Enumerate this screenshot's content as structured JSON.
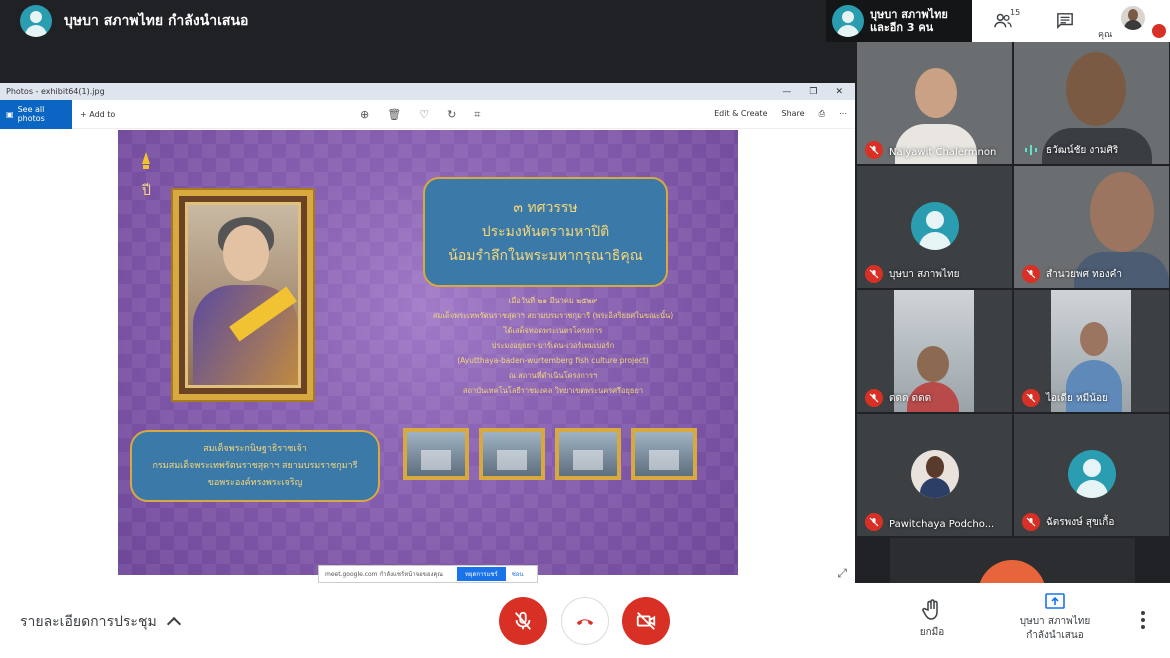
{
  "presenter": {
    "name": "บุษบา สภาพไทย กำลังนำเสนอ"
  },
  "others": {
    "line1": "บุษบา สภาพไทย",
    "line2": "และอีก 3 คน"
  },
  "header": {
    "participant_count": "15",
    "self_label": "คุณ"
  },
  "photos_app": {
    "window_title": "Photos - exhibit64(1).jpg",
    "see_all": "See all photos",
    "add_to": "+ Add to",
    "edit_create": "Edit & Create",
    "share": "Share"
  },
  "poster": {
    "corner_glyph": "ปี",
    "title_lines": [
      "๓ ทศวรรษ",
      "ประมงหันตรามหาปิติ",
      "น้อมรำลึกในพระมหากรุณาธิคุณ"
    ],
    "details": [
      "เมื่อวันที่ ๒๑ มีนาคม ๒๕๒๙",
      "สมเด็จพระเทพรัตนราชสุดาฯ สยามบรมราชกุมารี (พระอิสริยยศในขณะนั้น)",
      "ได้เสด็จทอดพระเนตรโครงการ",
      "ประมงอยุธยา-บาร์เดน-เวอร์เทมเบอร์ก",
      "(Ayutthaya-baden-wurtemberg fish culture project)",
      "ณ สถานที่ดำเนินโครงการฯ",
      "สถาบันเทคโนโลยีราชมงคล วิทยาเขตพระนครศรีอยุธยา"
    ],
    "caption_lines": [
      "สมเด็จพระกนิษฐาธิราชเจ้า",
      "กรมสมเด็จพระเทพรัตนราชสุดาฯ สยามบรมราชกุมารี",
      "ขอพระองค์ทรงพระเจริญ"
    ]
  },
  "share_banner": {
    "text": "meet.google.com กำลังแชร์หน้าจอของคุณ",
    "stop": "หยุดการแชร์",
    "hide": "ซ่อน"
  },
  "participants": [
    {
      "name": "Naiyawit Chalermnon",
      "muted": true
    },
    {
      "name": "ธวัฒน์ชัย งามศิริ",
      "muted": false
    },
    {
      "name": "บุษบา สภาพไทย",
      "muted": true
    },
    {
      "name": "สำนวยพศ ทองคำ",
      "muted": true
    },
    {
      "name": "ดดด ดดด",
      "muted": true
    },
    {
      "name": "ไอเดีย หมีน้อย",
      "muted": true
    },
    {
      "name": "Pawitchaya Podcho...",
      "muted": true
    },
    {
      "name": "ฉัตรพงษ์ สุขเกื้อ",
      "muted": true
    }
  ],
  "bottom": {
    "meeting_details": "รายละเอียดการประชุม",
    "raise_hand": "ยกมือ",
    "present_line1": "บุษบา สภาพไทย",
    "present_line2": "กำลังนำเสนอ"
  },
  "colors": {
    "danger": "#d93025",
    "avatar_teal": "#2a9db0",
    "frame_gold": "#d8a93f"
  }
}
